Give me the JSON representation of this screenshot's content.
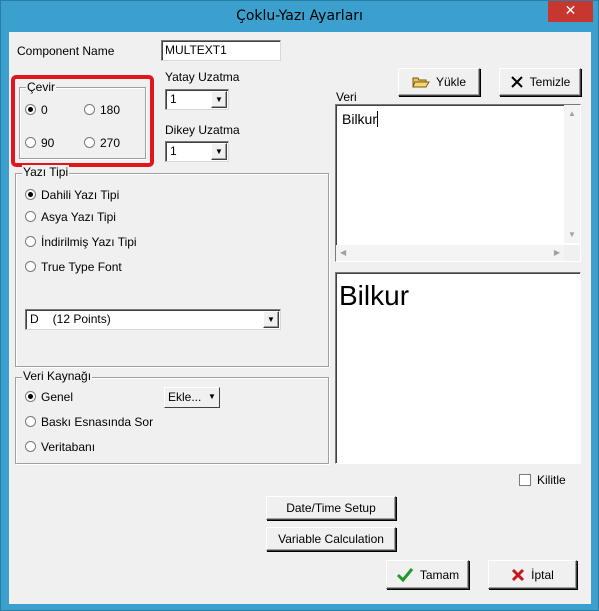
{
  "window": {
    "title": "Çoklu-Yazı Ayarları",
    "close_glyph": "✕"
  },
  "component_name": {
    "label": "Component Name",
    "value": "MULTEXT1"
  },
  "rotate": {
    "title": "Çevir",
    "options": [
      "0",
      "180",
      "90",
      "270"
    ],
    "selected": "0",
    "highlight_color": "#e1161d"
  },
  "horizontal_stretch": {
    "label": "Yatay Uzatma",
    "value": "1"
  },
  "vertical_stretch": {
    "label": "Dikey Uzatma",
    "value": "1"
  },
  "font_type": {
    "title": "Yazı Tipi",
    "options": [
      "Dahili Yazı Tipi",
      "Asya Yazı Tipi",
      "İndirilmiş Yazı Tipi",
      "True Type Font"
    ],
    "selected": "Dahili Yazı Tipi",
    "font_select": {
      "value": "D",
      "size": "(12  Points)"
    }
  },
  "data_source": {
    "title": "Veri Kaynağı",
    "options": [
      "Genel",
      "Baskı Esnasında Sor",
      "Veritabanı"
    ],
    "selected": "Genel",
    "add_button": "Ekle..."
  },
  "data": {
    "label": "Veri",
    "load_button": "Yükle",
    "clear_button": "Temizle",
    "text": "Bilkur",
    "preview_text": "Bilkur"
  },
  "lock": {
    "label": "Kilitle"
  },
  "buttons": {
    "datetime_setup": "Date/Time Setup",
    "variable_calculation": "Variable Calculation",
    "ok": "Tamam",
    "cancel": "İptal"
  },
  "icons": {
    "folder": "folder-open-icon",
    "clear": "x-icon",
    "ok": "checkmark-icon",
    "cancel": "red-x-icon"
  }
}
